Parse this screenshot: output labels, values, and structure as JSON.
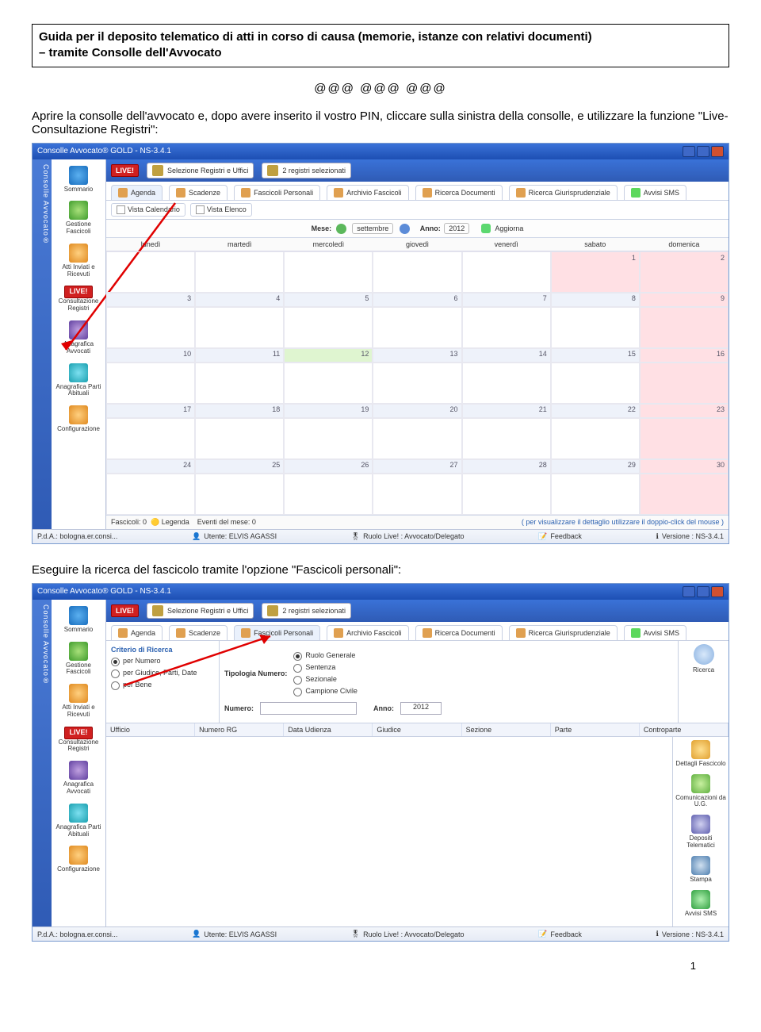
{
  "doc": {
    "title_line1": "Guida per il deposito telematico di atti in corso di causa (memorie, istanze con relativi documenti)",
    "title_line2": "– tramite Consolle dell'Avvocato",
    "separator": "@@@   @@@   @@@",
    "para1": "Aprire la consolle dell'avvocato e, dopo avere inserito il vostro PIN, cliccare sulla sinistra della consolle, e utilizzare la funzione \"Live- Consultazione Registri\":",
    "para2": "Eseguire la ricerca del fascicolo tramite l'opzione \"Fascicoli personali\":",
    "page_number": "1"
  },
  "app": {
    "title": "Consolle Avvocato® GOLD - NS-3.4.1",
    "rail_label": "Consolle Avvocato®",
    "header_box1": "Selezione Registri e Uffici",
    "header_box2": "2 registri selezionati"
  },
  "sidebar": {
    "items": [
      {
        "label": "Sommario"
      },
      {
        "label": "Gestione Fascicoli"
      },
      {
        "label": "Atti Inviati e Ricevuti"
      },
      {
        "label": "Consultazione Registri"
      },
      {
        "label": "Anagrafica Avvocati"
      },
      {
        "label": "Anagrafica Parti Abituali"
      },
      {
        "label": "Configurazione"
      }
    ],
    "live_label": "LIVE!"
  },
  "tabs": {
    "items": [
      {
        "label": "Agenda"
      },
      {
        "label": "Scadenze"
      },
      {
        "label": "Fascicoli Personali"
      },
      {
        "label": "Archivio Fascicoli"
      },
      {
        "label": "Ricerca Documenti"
      },
      {
        "label": "Ricerca Giurisprudenziale"
      },
      {
        "label": "Avvisi SMS"
      }
    ],
    "avvisi_badge": "SMS"
  },
  "view_tabs": {
    "calendar": "Vista Calendario",
    "list": "Vista Elenco"
  },
  "filters": {
    "mese_label": "Mese:",
    "mese_value": "settembre",
    "anno_label": "Anno:",
    "anno_value": "2012",
    "aggiorna": "Aggiorna"
  },
  "calendar": {
    "days": [
      "lunedì",
      "martedì",
      "mercoledì",
      "giovedì",
      "venerdì",
      "sabato",
      "domenica"
    ],
    "weeks": [
      [
        "",
        "",
        "",
        "",
        "",
        "1",
        "2"
      ],
      [
        "3",
        "4",
        "5",
        "6",
        "7",
        "8",
        "9"
      ],
      [
        "10",
        "11",
        "12",
        "13",
        "14",
        "15",
        "16"
      ],
      [
        "17",
        "18",
        "19",
        "20",
        "21",
        "22",
        "23"
      ],
      [
        "24",
        "25",
        "26",
        "27",
        "28",
        "29",
        "30"
      ]
    ],
    "legend_fascicoli": "Fascicoli: 0",
    "legend_label": "Legenda",
    "legend_eventi": "Eventi del mese: 0",
    "legend_hint": "( per visualizzare il dettaglio utilizzare il doppio-click del mouse )"
  },
  "statusbar": {
    "pda": "P.d.A.: bologna.er.consi...",
    "utente": "Utente: ELVIS AGASSI",
    "ruolo": "Ruolo Live! : Avvocato/Delegato",
    "feedback": "Feedback",
    "versione": "Versione : NS-3.4.1"
  },
  "search": {
    "criteria_title": "Criterio di Ricerca",
    "r1": "per Numero",
    "r2": "per Giudice, Parti, Date",
    "r3": "per Bene",
    "tip_label": "Tipologia Numero:",
    "tip_opts": [
      "Ruolo Generale",
      "Sentenza",
      "Sezionale",
      "Campione Civile"
    ],
    "numero_label": "Numero:",
    "anno_label": "Anno:",
    "anno_value": "2012",
    "ricerca_btn": "Ricerca"
  },
  "result_cols": [
    "Ufficio",
    "Numero RG",
    "Data Udienza",
    "Giudice",
    "Sezione",
    "Parte",
    "Controparte"
  ],
  "right_actions": [
    {
      "label": "Dettagli Fascicolo"
    },
    {
      "label": "Comunicazioni da U.G."
    },
    {
      "label": "Depositi Telematici"
    },
    {
      "label": "Stampa"
    },
    {
      "label": "Avvisi SMS"
    }
  ]
}
